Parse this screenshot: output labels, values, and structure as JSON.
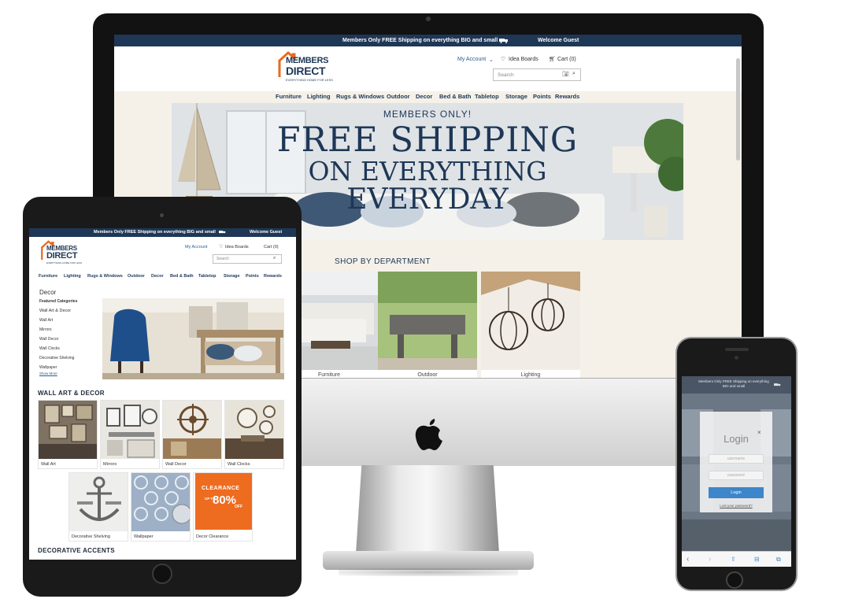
{
  "brand": {
    "line1": "MEMBERS",
    "line2": "DIRECT",
    "tagline": "EVERYTHING HOME FOR LESS",
    "colors": {
      "navy": "#1e3756",
      "orange": "#e96a1f",
      "link": "#2a5d8a",
      "login_button": "#3c86c9"
    }
  },
  "topbar": {
    "message": "Members Only FREE Shipping on everything BIG and small",
    "welcome": "Welcome Guest",
    "truck_icon": "truck-icon"
  },
  "header": {
    "my_account": "My Account",
    "idea_boards": "Idea Boards",
    "cart": "Cart (0)",
    "search_placeholder": "Search"
  },
  "nav": [
    "Furniture",
    "Lighting",
    "Rugs & Windows",
    "Outdoor",
    "Decor",
    "Bed & Bath",
    "Tabletop",
    "Storage",
    "Points",
    "Rewards"
  ],
  "hero": {
    "line1": "MEMBERS ONLY!",
    "line2": "FREE SHIPPING",
    "line3": "ON EVERYTHING",
    "line4": "EVERYDAY"
  },
  "shop": {
    "heading": "SHOP BY DEPARTMENT",
    "departments": [
      "Furniture",
      "Outdoor",
      "Lighting"
    ]
  },
  "tablet": {
    "top_message": "Members Only FREE Shipping on everything BIG and small",
    "welcome": "Welcome Guest",
    "sidebar": {
      "title": "Decor",
      "subtitle": "Featured Categories",
      "items": [
        "Wall Art & Decor",
        "Wall Art",
        "Mirrors",
        "Wall Decor",
        "Wall Clocks",
        "Decorative Shelving",
        "Wallpaper"
      ],
      "show_more": "Show More"
    },
    "section1": "WALL ART & DECOR",
    "row1": [
      "Wall Art",
      "Mirrors",
      "Wall Decor",
      "Wall Clocks"
    ],
    "row2": [
      "Decorative Shelving",
      "Wallpaper",
      "Decor Clearance"
    ],
    "clearance": {
      "word": "CLEARANCE",
      "up_to": "UP TO",
      "percent": "80%",
      "off": "OFF"
    },
    "section2": "DECORATIVE ACCENTS"
  },
  "phone": {
    "top_message": "Members Only FREE Shipping on everything BIG and small",
    "login": {
      "title": "Login",
      "close": "×",
      "username": "username",
      "password": "password",
      "button": "Login",
      "forgot": "Lost your password?"
    },
    "toolbar": {
      "back": "‹",
      "forward": "›",
      "share": "⇪",
      "bookmarks": "⊟",
      "tabs": "⧉"
    }
  }
}
